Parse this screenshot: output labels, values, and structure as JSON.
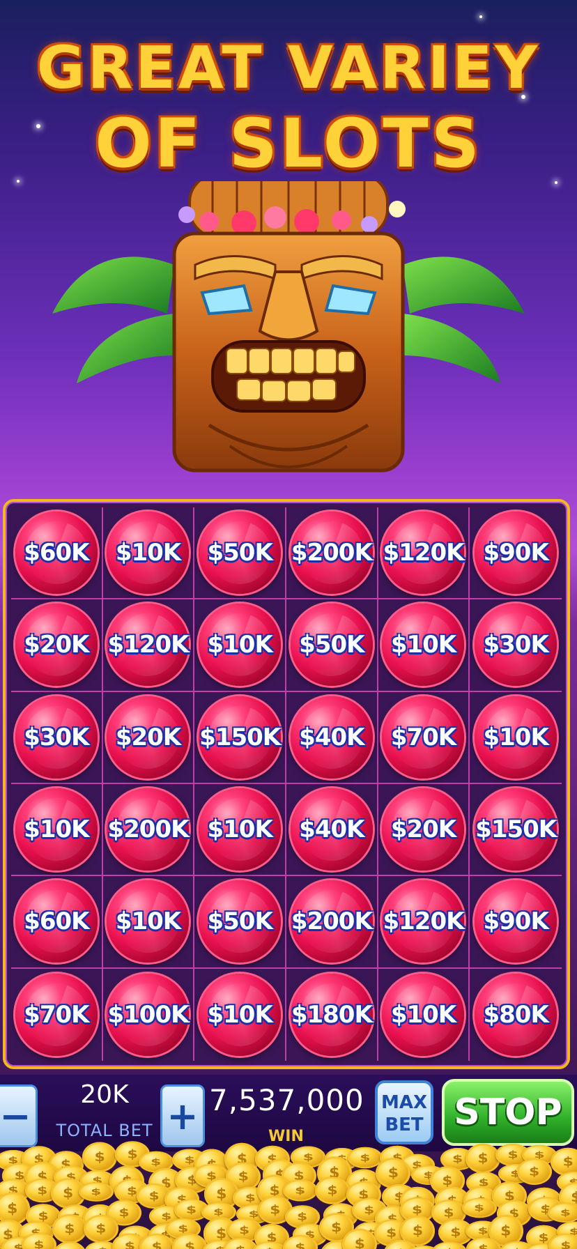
{
  "title": {
    "line1": "GREAT VARIEY",
    "line2": "OF SLOTS"
  },
  "board": {
    "rows": [
      [
        "$60K",
        "$10K",
        "$50K",
        "$200K",
        "$120K",
        "$90K"
      ],
      [
        "$20K",
        "$120K",
        "$10K",
        "$50K",
        "$10K",
        "$30K"
      ],
      [
        "$30K",
        "$20K",
        "$150K",
        "$40K",
        "$70K",
        "$10K"
      ],
      [
        "$10K",
        "$200K",
        "$10K",
        "$40K",
        "$20K",
        "$150K"
      ],
      [
        "$60K",
        "$10K",
        "$50K",
        "$200K",
        "$120K",
        "$90K"
      ],
      [
        "$70K",
        "$100K",
        "$10K",
        "$180K",
        "$10K",
        "$80K"
      ]
    ]
  },
  "controls": {
    "minus": "−",
    "plus": "+",
    "bet_value": "20K",
    "bet_label": "TOTAL BET",
    "win_value": "7,537,000",
    "win_label": "WIN",
    "max_bet_line1": "MAX",
    "max_bet_line2": "BET",
    "stop_label": "STOP"
  },
  "coin_symbol": "$",
  "colors": {
    "title": "#ffd23a",
    "gem": "#e8104e",
    "value_outline": "#1b2fa6",
    "board_border": "#f3b81e",
    "stop": "#2fb02a"
  },
  "icons": [
    "tiki-mask-icon",
    "coin-icon",
    "gem-icon"
  ]
}
